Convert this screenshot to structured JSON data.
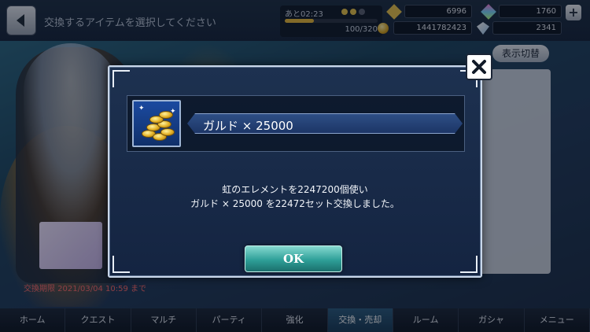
{
  "header": {
    "page_title": "交換するアイテムを選択してください",
    "stamina_time": "あと02:23",
    "stamina_value": "100/320",
    "stamina_fill": 0.31,
    "gems_yellow": "6996",
    "gems_rainbow": "1760",
    "gil": "1441782423",
    "diamonds": "2341",
    "plus_label": "+"
  },
  "list": {
    "switch_label": "表示切替",
    "deadline": "交換期限 2021/03/04 10:59 まで"
  },
  "modal": {
    "item_name": "ガルド × 25000",
    "message_line1": "虹のエレメントを2247200個使い",
    "message_line2": "ガルド × 25000 を22472セット交換しました。",
    "ok_label": "OK"
  },
  "bottom_nav": {
    "items": [
      "ホーム",
      "クエスト",
      "マルチ",
      "パーティ",
      "強化",
      "交換・売却",
      "ルーム",
      "ガシャ",
      "メニュー"
    ],
    "active_index": 5
  },
  "colors": {
    "accent_ok": "#2e9f98",
    "deadline": "#ff6b6b"
  }
}
